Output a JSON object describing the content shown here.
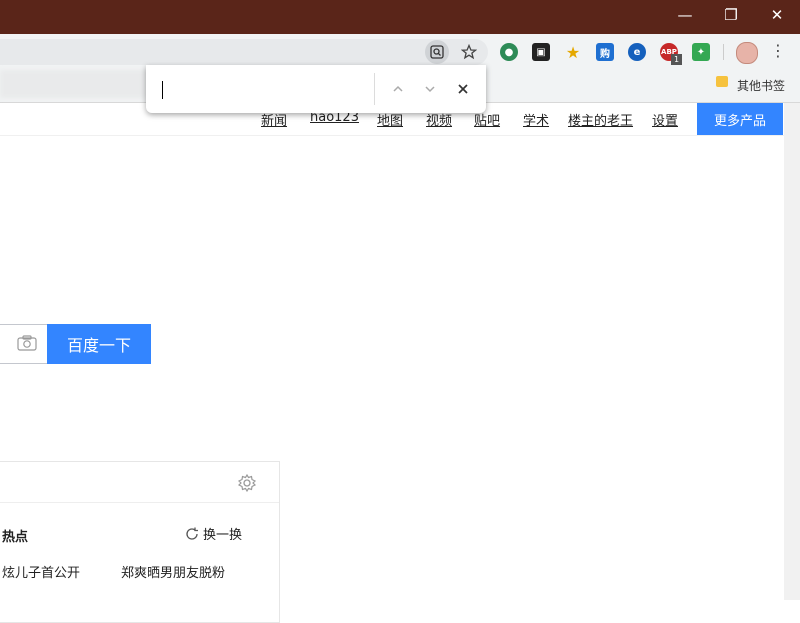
{
  "window": {
    "minimize": "—",
    "restore": "❐",
    "close": "✕"
  },
  "toolbar": {
    "find_icon": "search-page-icon",
    "star_icon": "star-icon",
    "extensions": [
      {
        "name": "globe-extension-icon",
        "glyph": "●",
        "color": "#2e8b57"
      },
      {
        "name": "tab-manager-extension-icon",
        "glyph": "▣",
        "color": "#222222"
      },
      {
        "name": "bookmark-star-extension-icon",
        "glyph": "★",
        "color": "#e5a800"
      },
      {
        "name": "shopping-extension-icon",
        "glyph": "购",
        "color": "#1f6fd1"
      },
      {
        "name": "e-extension-icon",
        "glyph": "e",
        "color": "#1560bd"
      },
      {
        "name": "adblock-extension-icon",
        "glyph": "ABP",
        "color": "#c62828",
        "badge": "1"
      },
      {
        "name": "color-picker-extension-icon",
        "glyph": "✦",
        "color": "#34a853"
      }
    ],
    "menu": "⋮"
  },
  "bookmarks": {
    "other": "其他书签"
  },
  "findbar": {
    "query": "",
    "up": "⌃",
    "down": "⌄",
    "close": "✕"
  },
  "nav": {
    "links": [
      "新闻",
      "hao123",
      "地图",
      "视频",
      "贴吧",
      "学术",
      "楼主的老王",
      "设置"
    ],
    "more": "更多产品"
  },
  "search": {
    "button": "百度一下"
  },
  "hot": {
    "title": "热点",
    "refresh": "换一换",
    "items": [
      "炫儿子首公开",
      "郑爽晒男朋友脱粉"
    ]
  }
}
